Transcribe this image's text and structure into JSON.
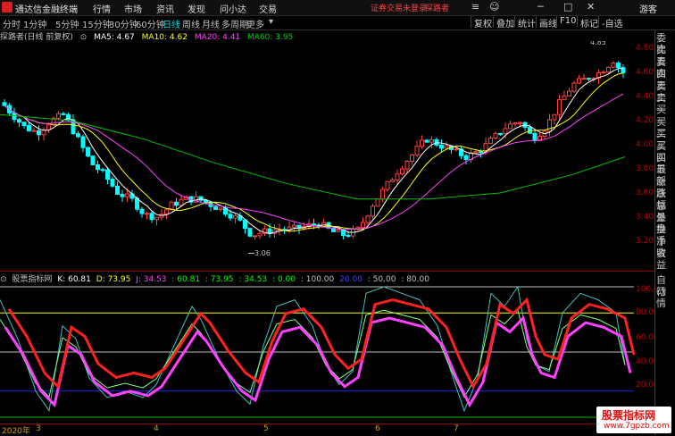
{
  "app_title": "通达信金融终端",
  "menu": [
    "行情",
    "市场",
    "资讯",
    "发现",
    "问小达",
    "交易"
  ],
  "login_status": "证券交易未登录",
  "explorer": "探路者",
  "guest": "游客",
  "periods": [
    "分时",
    "1分钟",
    "5分钟",
    "15分钟",
    "30分钟",
    "60分钟",
    "日线",
    "周线",
    "月线",
    "多周期",
    "更多"
  ],
  "active_period": "日线",
  "toolbar": [
    "复权",
    "叠加",
    "统计",
    "画线",
    "F10",
    "标记",
    "-自选"
  ],
  "main_indicator": {
    "stock": "探路者(日线 前复权)",
    "ma5": "MA5: 4.67",
    "ma10": "MA10: 4.62",
    "ma20": "MA20: 4.41",
    "ma60": "MA60: 3.95"
  },
  "kdj": {
    "name": "股票指标网",
    "k": "K: 60.81",
    "d": "D: 73.95",
    "j": "J: 34.53",
    "v1": ": 60.81",
    "v2": ": 73.95",
    "v3": ": 34.53",
    "v4": ": 0.00",
    "v5": ": 100.00",
    "v6": "20.00",
    "v7": ": 50.00",
    "v8": ": 80.00"
  },
  "price_axis": [
    "4.80",
    "4.60",
    "4.40",
    "4.20",
    "4.00",
    "3.80",
    "3.60",
    "3.40",
    "3.20"
  ],
  "kdj_axis": [
    "100.00",
    "80.00",
    "60.00",
    "40.00",
    "20.00"
  ],
  "high_label": "4.85",
  "low_label": "3.06",
  "x_labels": [
    "2020年",
    "3",
    "4",
    "5",
    "6",
    "7"
  ],
  "right_panel": [
    "委比",
    "卖五",
    "卖四",
    "卖三",
    "卖二",
    "卖一",
    "买一",
    "买二",
    "买三",
    "买四",
    "买五",
    "最新",
    "涨跌",
    "涨幅",
    "总量",
    "外盘",
    "换手",
    "净资",
    "收益"
  ],
  "right_panel_bottom": [
    "自动",
    "行情"
  ],
  "watermark": {
    "line1": "股票指标网",
    "line2": "www.7gpzb.com"
  },
  "colors": {
    "up": "#ff4040",
    "down": "#00ffff",
    "ma5": "#ffffff",
    "ma10": "#ffff00",
    "ma20": "#ff40ff",
    "ma60": "#00c000"
  }
}
